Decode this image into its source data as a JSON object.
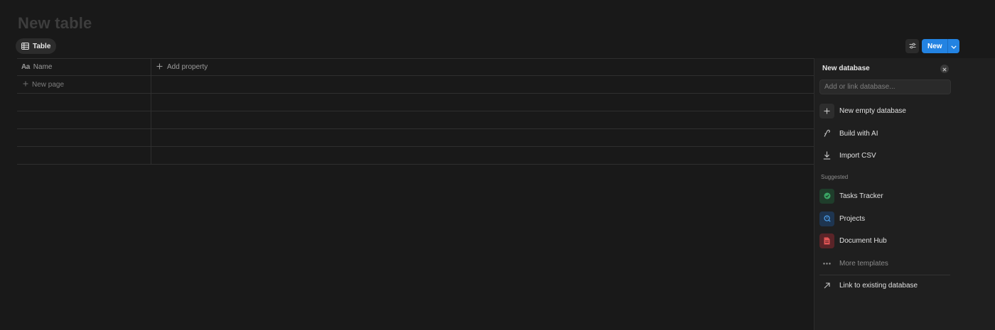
{
  "page": {
    "title": "New table"
  },
  "view": {
    "tab_label": "Table"
  },
  "toolbar": {
    "new_label": "New"
  },
  "table": {
    "name_header": "Name",
    "name_header_icon": "Aa",
    "add_property_label": "Add property",
    "new_page_label": "New page"
  },
  "panel": {
    "title": "New database",
    "search_placeholder": "Add or link database...",
    "actions": [
      {
        "label": "New empty database",
        "icon": "plus-icon"
      },
      {
        "label": "Build with AI",
        "icon": "ai-icon"
      },
      {
        "label": "Import CSV",
        "icon": "download-icon"
      }
    ],
    "suggested_label": "Suggested",
    "suggested": [
      {
        "label": "Tasks Tracker",
        "icon": "check-circle-icon",
        "color": "#2f7d4c",
        "bg": "#1f3d2b"
      },
      {
        "label": "Projects",
        "icon": "projects-icon",
        "color": "#3b8ed8",
        "bg": "#1e3550"
      },
      {
        "label": "Document Hub",
        "icon": "document-icon",
        "color": "#e05555",
        "bg": "#5a2428"
      }
    ],
    "more_templates": "More templates",
    "link_existing": "Link to existing database"
  },
  "colors": {
    "accent": "#2383e2",
    "background": "#191919",
    "panel": "#1f1f1f"
  }
}
